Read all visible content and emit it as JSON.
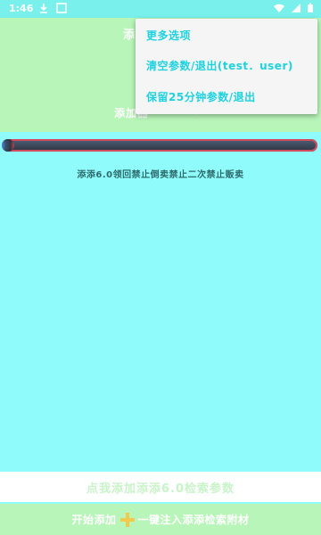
{
  "status_bar": {
    "time": "1:46",
    "icons": [
      "download-icon",
      "app-icon",
      "wifi-icon",
      "signal-icon",
      "battery-icon"
    ]
  },
  "header": {
    "title_visible_part": "添",
    "subtitle_visible_part": "添加器"
  },
  "menu": {
    "items": [
      "更多选项",
      "清空参数/退出(test．user)",
      "保留25分钟参数/退出"
    ]
  },
  "progress": {
    "value_fraction": 0.02
  },
  "warning": {
    "text": "添添6.0领回禁止倒卖禁止二次禁止贩卖"
  },
  "buttons": {
    "white_label": "点我添加添添6.0检索参数",
    "green_left": "开始添加",
    "green_right": "一键注入添添检索附材"
  },
  "colors": {
    "background": "#8ffcfb",
    "green_bar": "#b8f5b8",
    "menu_text": "#1fd2e0",
    "progress_border": "#d24b5c"
  }
}
